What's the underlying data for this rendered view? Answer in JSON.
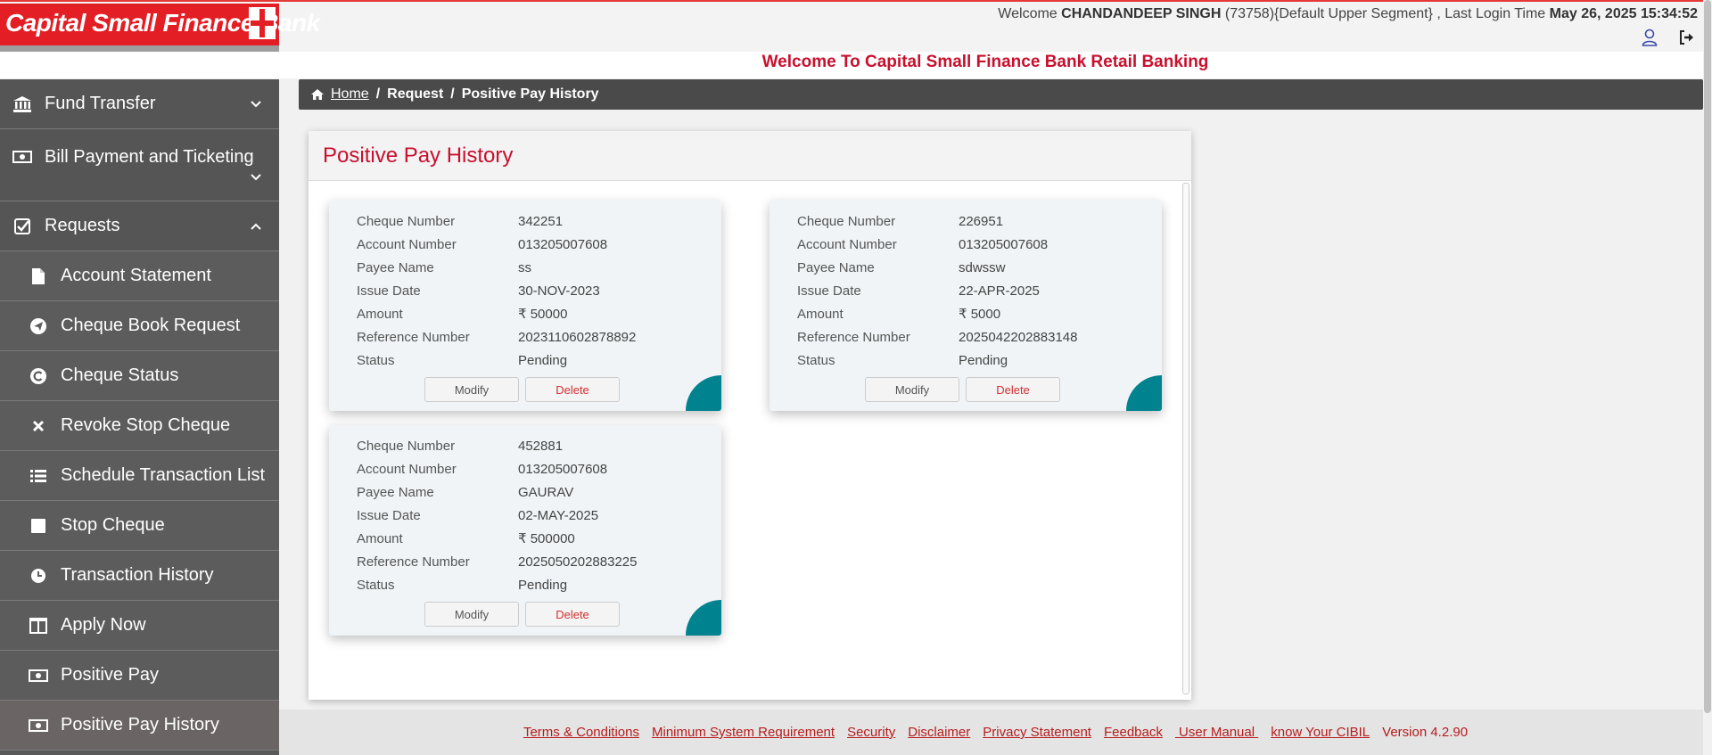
{
  "header": {
    "logo_text": "Capital Small Finance Bank",
    "welcome_prefix": "Welcome",
    "user_name": "CHANDANDEEP SINGH",
    "user_meta": "(73758){Default Upper Segment} , Last Login Time",
    "last_login": "May 26, 2025 15:34:52",
    "banner": "Welcome To Capital Small Finance Bank Retail Banking",
    "icons": [
      "user-icon",
      "logout-icon"
    ]
  },
  "sidebar": {
    "items": [
      {
        "label": "Fund Transfer",
        "icon": "bank-icon",
        "chevron": "down"
      },
      {
        "label": "Bill Payment and Ticketing",
        "icon": "money-icon",
        "chevron": "down"
      },
      {
        "label": "Requests",
        "icon": "checkbox-icon",
        "chevron": "up"
      },
      {
        "label": "Account Statement",
        "icon": "file-icon"
      },
      {
        "label": "Cheque Book Request",
        "icon": "send-icon"
      },
      {
        "label": "Cheque Status",
        "icon": "copyright-icon"
      },
      {
        "label": "Revoke Stop Cheque",
        "icon": "close-icon"
      },
      {
        "label": "Schedule Transaction List",
        "icon": "list-icon"
      },
      {
        "label": "Stop Cheque",
        "icon": "square-icon"
      },
      {
        "label": "Transaction History",
        "icon": "clock-icon"
      },
      {
        "label": "Apply Now",
        "icon": "columns-icon"
      },
      {
        "label": "Positive Pay",
        "icon": "money-icon"
      },
      {
        "label": "Positive Pay History",
        "icon": "money-icon"
      }
    ]
  },
  "breadcrumb": {
    "home": "Home",
    "sep": "/",
    "request": "Request",
    "current": "Positive Pay History"
  },
  "panel": {
    "title": "Positive Pay History"
  },
  "labels": {
    "cheque_number": "Cheque Number",
    "account_number": "Account Number",
    "payee_name": "Payee Name",
    "issue_date": "Issue Date",
    "amount": "Amount",
    "reference_number": "Reference Number",
    "status": "Status",
    "modify": "Modify",
    "delete": "Delete"
  },
  "cards": [
    {
      "cheque_number": "342251",
      "account_number": "013205007608",
      "payee_name": "ss",
      "issue_date": "30-NOV-2023",
      "amount": "₹ 50000",
      "reference_number": "2023110602878892",
      "status": "Pending"
    },
    {
      "cheque_number": "226951",
      "account_number": "013205007608",
      "payee_name": "sdwssw",
      "issue_date": "22-APR-2025",
      "amount": "₹ 5000",
      "reference_number": "2025042202883148",
      "status": "Pending"
    },
    {
      "cheque_number": "452881",
      "account_number": "013205007608",
      "payee_name": "GAURAV",
      "issue_date": "02-MAY-2025",
      "amount": "₹ 500000",
      "reference_number": "2025050202883225",
      "status": "Pending"
    }
  ],
  "footer": {
    "links": [
      "Terms & Conditions",
      "Minimum System Requirement",
      "Security",
      "Disclaimer",
      "Privacy Statement",
      "Feedback",
      " User Manual ",
      "know Your CIBIL"
    ],
    "version": "Version 4.2.90"
  },
  "colors": {
    "brand_red": "#e31e24",
    "title_red": "#c8102e",
    "sidebar": "#595959",
    "teal": "#00838f"
  }
}
